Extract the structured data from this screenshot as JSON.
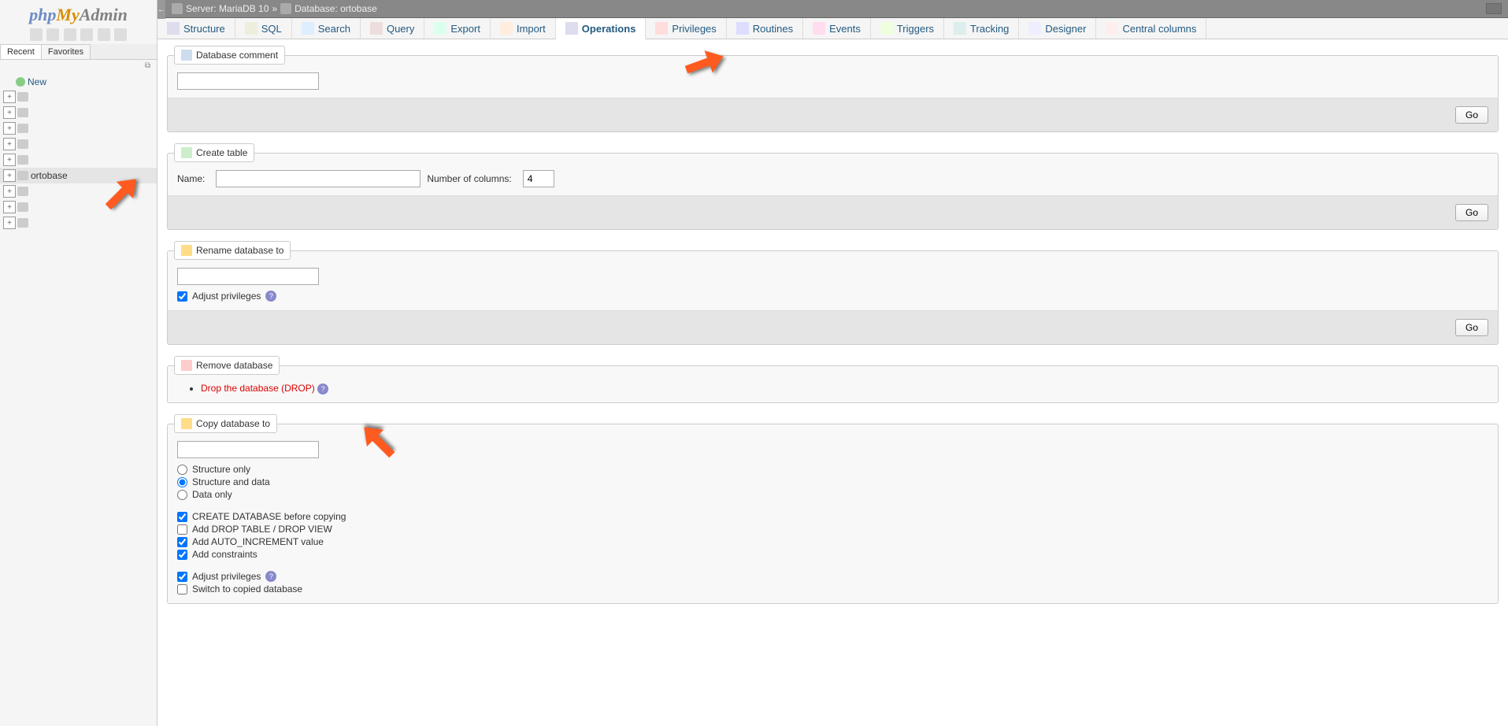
{
  "logo": {
    "p1": "php",
    "p2": "My",
    "p3": "Admin"
  },
  "nav_tabs": {
    "recent": "Recent",
    "favorites": "Favorites"
  },
  "tree": {
    "new_label": "New",
    "selected_db": "ortobase",
    "empty_count": 9
  },
  "breadcrumb": {
    "server_label": "Server:",
    "server_value": "MariaDB 10",
    "sep": "»",
    "db_label": "Database:",
    "db_value": "ortobase"
  },
  "tabs": [
    {
      "key": "structure",
      "label": "Structure"
    },
    {
      "key": "sql",
      "label": "SQL"
    },
    {
      "key": "search",
      "label": "Search"
    },
    {
      "key": "query",
      "label": "Query"
    },
    {
      "key": "export",
      "label": "Export"
    },
    {
      "key": "import",
      "label": "Import"
    },
    {
      "key": "operations",
      "label": "Operations",
      "active": true
    },
    {
      "key": "privileges",
      "label": "Privileges"
    },
    {
      "key": "routines",
      "label": "Routines"
    },
    {
      "key": "events",
      "label": "Events"
    },
    {
      "key": "triggers",
      "label": "Triggers"
    },
    {
      "key": "tracking",
      "label": "Tracking"
    },
    {
      "key": "designer",
      "label": "Designer"
    },
    {
      "key": "central",
      "label": "Central columns"
    }
  ],
  "buttons": {
    "go": "Go"
  },
  "sections": {
    "comment": {
      "legend": "Database comment",
      "value": ""
    },
    "create_table": {
      "legend": "Create table",
      "name_label": "Name:",
      "name_value": "",
      "cols_label": "Number of columns:",
      "cols_value": "4"
    },
    "rename": {
      "legend": "Rename database to",
      "value": "",
      "adjust_label": "Adjust privileges",
      "adjust_checked": true
    },
    "remove": {
      "legend": "Remove database",
      "drop_link": "Drop the database (DROP)"
    },
    "copy": {
      "legend": "Copy database to",
      "value": "",
      "radio_structure": "Structure only",
      "radio_both": "Structure and data",
      "radio_data": "Data only",
      "radio_selected": "both",
      "chk_create_db": {
        "label": "CREATE DATABASE before copying",
        "checked": true
      },
      "chk_drop": {
        "label": "Add DROP TABLE / DROP VIEW",
        "checked": false
      },
      "chk_autoinc": {
        "label": "Add AUTO_INCREMENT value",
        "checked": true
      },
      "chk_constraints": {
        "label": "Add constraints",
        "checked": true
      },
      "chk_adjust": {
        "label": "Adjust privileges",
        "checked": true
      },
      "chk_switch": {
        "label": "Switch to copied database",
        "checked": false
      }
    }
  }
}
